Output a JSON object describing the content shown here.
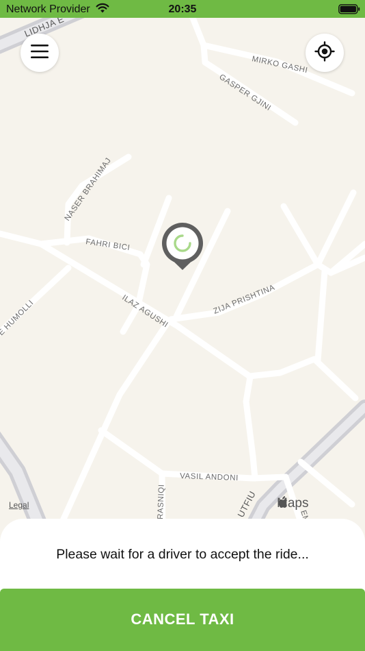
{
  "status_bar": {
    "carrier": "Network Provider",
    "time": "20:35"
  },
  "map": {
    "streets": {
      "lidhja": "LIDHJA E",
      "mirko_gashi": "MIRKO GASHI",
      "gasper_gjini": "GASPER GJINI",
      "naser_brahimaj": "NASER BRAHIMAJ",
      "fahri_bici": "FAHRI BICI",
      "humolli": "E HUMOLLI",
      "ilaz_agushi": "ILAZ AGUSHI",
      "zija_prishtina": "ZIJA PRISHTINA",
      "vasil_andoni": "VASIL ANDONI",
      "rasniqi": "RASNIQI",
      "utfiu": "UTFIU",
      "em": "EM"
    },
    "legal_label": "Legal",
    "maps_brand": "Maps"
  },
  "icons": {
    "menu": "hamburger-icon",
    "locate": "crosshair-icon",
    "pin": "map-pin-icon"
  },
  "colors": {
    "brand_green": "#6fba44",
    "map_background": "#f6f3ec",
    "pin_gray": "#5f5f5f"
  },
  "bottom_sheet": {
    "message": "Please wait for a driver to accept the ride...",
    "cancel_label": "CANCEL TAXI"
  }
}
